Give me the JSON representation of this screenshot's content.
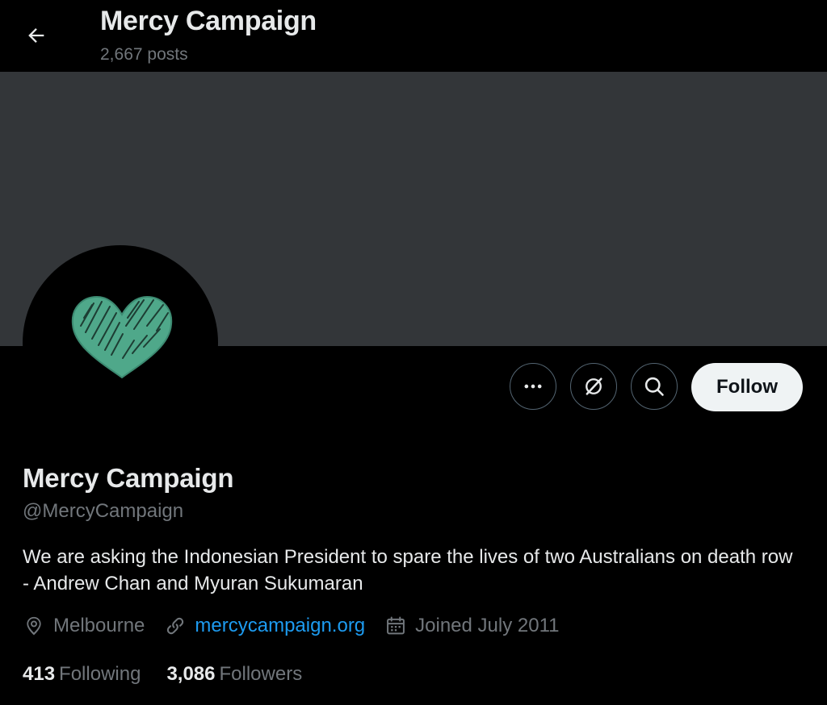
{
  "header": {
    "title": "Mercy Campaign",
    "posts_count": "2,667 posts"
  },
  "profile": {
    "display_name": "Mercy Campaign",
    "handle": "@MercyCampaign",
    "bio": "We are asking the Indonesian President to spare the lives of two Australians on death row - Andrew Chan and Myuran Sukumaran",
    "location": "Melbourne",
    "website": "mercycampaign.org",
    "joined": "Joined July 2011",
    "following_count": "413",
    "following_label": "Following",
    "followers_count": "3,086",
    "followers_label": "Followers"
  },
  "actions": {
    "follow_label": "Follow",
    "more_icon": "more-icon",
    "grok_icon": "grok-icon",
    "search_icon": "search-icon"
  },
  "colors": {
    "background": "#000000",
    "banner": "#333639",
    "heart": "#4fa88a",
    "link": "#1d9bf0",
    "muted": "#71767b",
    "text": "#e7e9ea"
  }
}
